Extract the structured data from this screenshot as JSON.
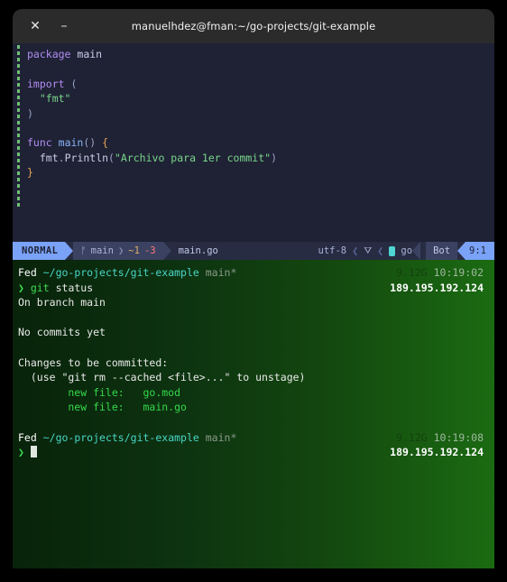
{
  "window": {
    "title": "manuelhdez@fman:~/go-projects/git-example",
    "close_label": "✕",
    "minimize_label": "–"
  },
  "editor": {
    "lines": [
      {
        "text": "package main",
        "parts": [
          {
            "t": "package",
            "c": "kw"
          },
          {
            "t": " ",
            "c": "pun"
          },
          {
            "t": "main",
            "c": "id"
          }
        ]
      },
      {
        "text": ""
      },
      {
        "text": "import (",
        "parts": [
          {
            "t": "import",
            "c": "kw"
          },
          {
            "t": " ",
            "c": "pun"
          },
          {
            "t": "(",
            "c": "pun"
          }
        ]
      },
      {
        "text": "  \"fmt\"",
        "parts": [
          {
            "t": "  ",
            "c": "pun"
          },
          {
            "t": "\"fmt\"",
            "c": "str"
          }
        ]
      },
      {
        "text": ")",
        "parts": [
          {
            "t": ")",
            "c": "pun"
          }
        ]
      },
      {
        "text": ""
      },
      {
        "text": "func main() {",
        "parts": [
          {
            "t": "func",
            "c": "kw"
          },
          {
            "t": " ",
            "c": "pun"
          },
          {
            "t": "main",
            "c": "fn"
          },
          {
            "t": "() ",
            "c": "pun"
          },
          {
            "t": "{",
            "c": "brace"
          }
        ]
      },
      {
        "text": "  fmt.Println(\"Archivo para 1er commit\")",
        "parts": [
          {
            "t": "  ",
            "c": "pun"
          },
          {
            "t": "fmt",
            "c": "id"
          },
          {
            "t": ".",
            "c": "pun"
          },
          {
            "t": "Println",
            "c": "id"
          },
          {
            "t": "(",
            "c": "pun"
          },
          {
            "t": "\"Archivo para 1er commit\"",
            "c": "str"
          },
          {
            "t": ")",
            "c": "pun"
          }
        ]
      },
      {
        "text": "}",
        "parts": [
          {
            "t": "}",
            "c": "brace"
          }
        ]
      }
    ]
  },
  "statusline": {
    "mode": "NORMAL",
    "branch_icon": "ᚠ",
    "branch": "main",
    "separator": "❯",
    "diff_added": "~1",
    "diff_removed": "-3",
    "filename": "main.go",
    "encoding": "utf-8",
    "os_icon": "⛛",
    "filetype": "go",
    "scroll_position": "Bot",
    "cursor_position": "9:1"
  },
  "terminal": {
    "prompt1": {
      "host": "Fed",
      "path": "~/go-projects/git-example",
      "git_branch": "main*",
      "memory": "9.12G",
      "time": "10:19:02",
      "ip": "189.195.192.124"
    },
    "command": {
      "chevron": "❯",
      "program": "git",
      "args": "status"
    },
    "output": [
      "On branch main",
      "",
      "No commits yet",
      "",
      "Changes to be committed:",
      "  (use \"git rm --cached <file>...\" to unstage)"
    ],
    "staged_files": [
      {
        "status": "        new file:   ",
        "name": "go.mod"
      },
      {
        "status": "        new file:   ",
        "name": "main.go"
      }
    ],
    "prompt2": {
      "host": "Fed",
      "path": "~/go-projects/git-example",
      "git_branch": "main*",
      "memory": "9.12G",
      "time": "10:19:08",
      "ip": "189.195.192.124"
    },
    "input_chevron": "❯",
    "input_value": ""
  },
  "colors": {
    "accent": "#7aa2f7",
    "terminal_green": "#3ddc52",
    "path_cyan": "#49d6c8",
    "titlebar": "#2b2b2b",
    "editor_bg": "#1f2235"
  }
}
